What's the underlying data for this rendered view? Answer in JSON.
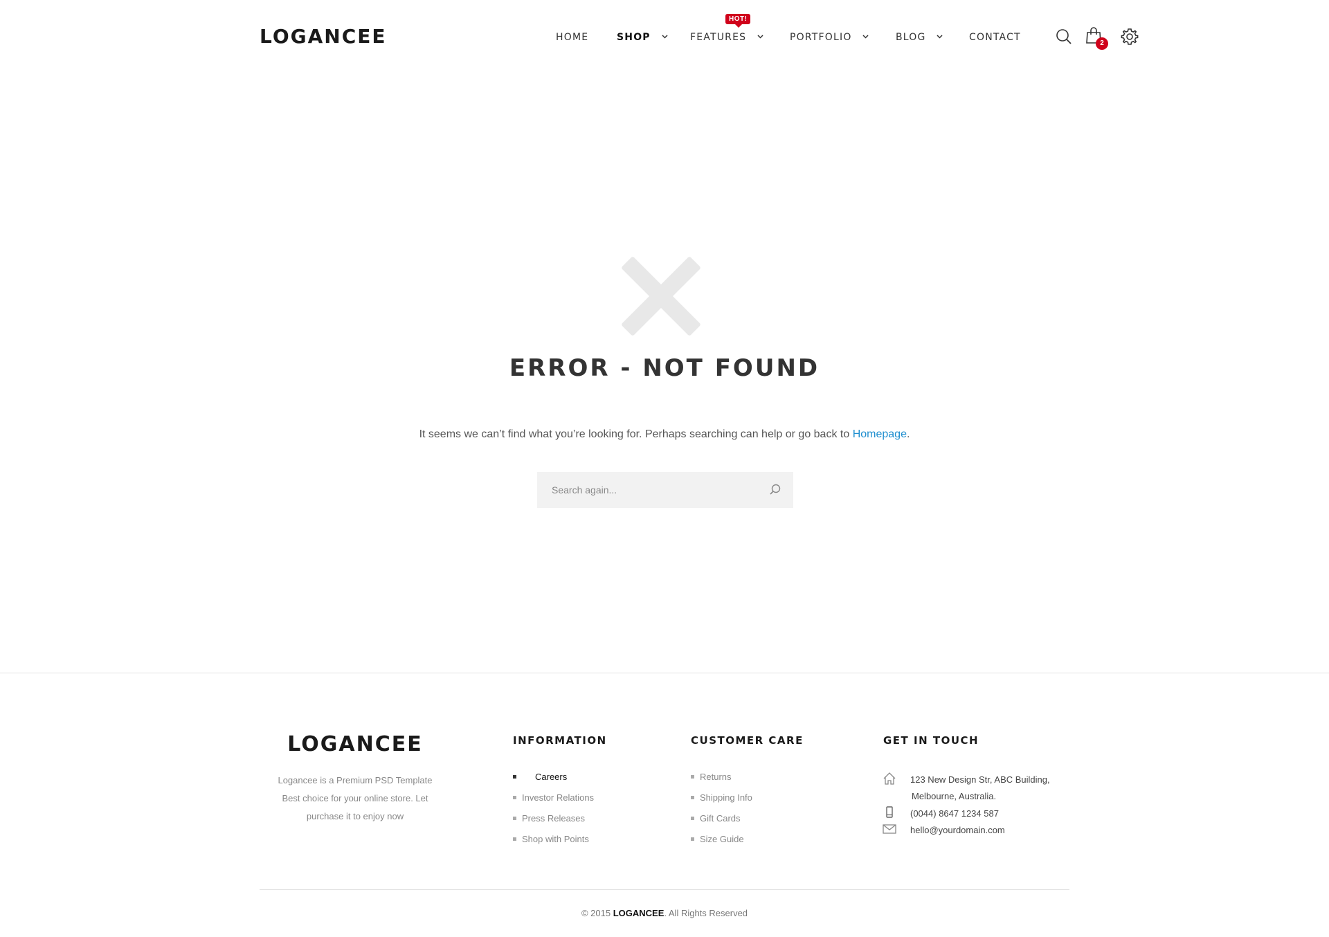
{
  "header": {
    "logo": "LOGANCEE",
    "nav": [
      {
        "label": "HOME"
      },
      {
        "label": "SHOP"
      },
      {
        "label": "FEATURES"
      },
      {
        "label": "PORTFOLIO"
      },
      {
        "label": "BLOG"
      },
      {
        "label": "CONTACT"
      }
    ],
    "hot_badge": "HOT!",
    "cart_count": "2",
    "icons": [
      "search-icon",
      "shopping-bag-icon",
      "gear-icon"
    ]
  },
  "main": {
    "icon": "close-x-icon",
    "title": "ERROR - NOT FOUND",
    "message": "It seems we can’t find what you’re looking for. Perhaps searching can help or go back to ",
    "home_link": "Homepage",
    "message_end": ".",
    "search_placeholder": "Search again..."
  },
  "footer": {
    "logo": "LOGANCEE",
    "description_lines": [
      "Logancee is a Premium PSD Template",
      "Best choice for your online store. Let",
      "purchase it to enjoy now"
    ],
    "information": {
      "heading": "INFORMATION",
      "items": [
        "Careers",
        "Investor Relations",
        "Press Releases",
        "Shop with Points"
      ]
    },
    "customer_care": {
      "heading": "CUSTOMER CARE",
      "items": [
        "Returns",
        "Shipping Info",
        "Gift Cards",
        "Size Guide"
      ]
    },
    "contact": {
      "heading": "GET IN TOUCH",
      "address_line1": "123 New Design Str, ABC Building,",
      "address_line2": "Melbourne, Australia.",
      "phone": "(0044) 8647 1234 587",
      "email": "hello@yourdomain.com"
    },
    "copyright_prefix": "© 2015",
    "copyright_brand": "LOGANCEE",
    "copyright_suffix": ". All Rights Reserved"
  },
  "colors": {
    "accent_red": "#d0021b",
    "link_blue": "#1e8ecf",
    "icon_gray": "#e8e8e8"
  }
}
